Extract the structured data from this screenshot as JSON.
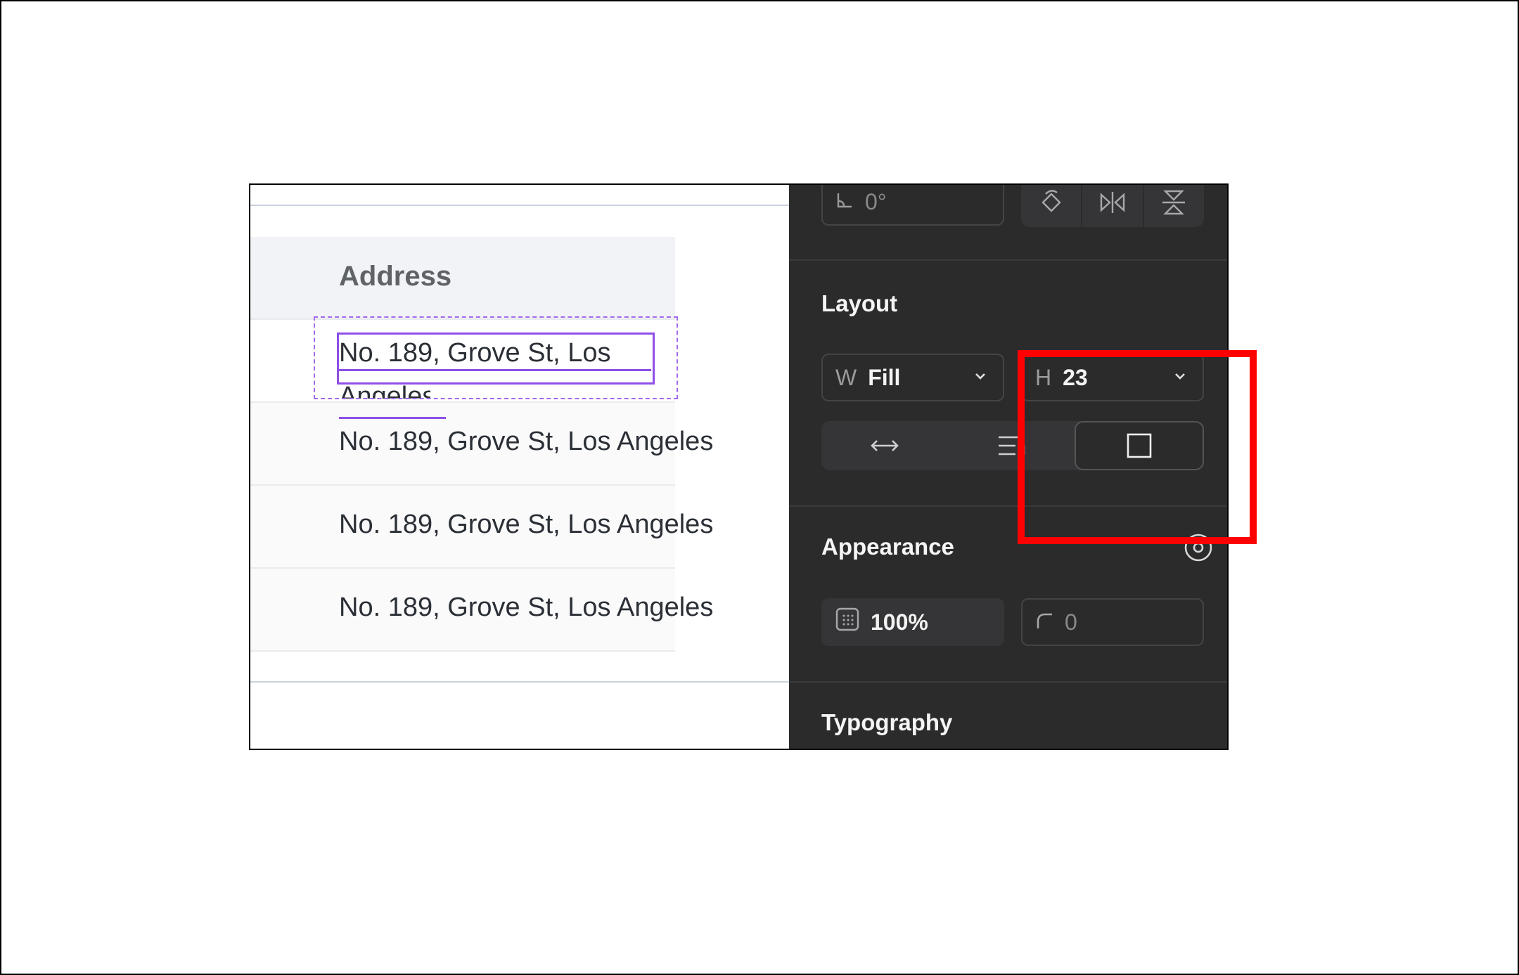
{
  "table": {
    "header": "Address",
    "rows": [
      "No. 189, Grove St, Los",
      "No. 189, Grove St, Los Angeles",
      "No. 189, Grove St, Los Angeles",
      "No. 189, Grove St, Los Angeles"
    ],
    "overflow_suffix": "Angeles"
  },
  "inspector": {
    "rotation": {
      "value": "0°"
    },
    "layout": {
      "title": "Layout",
      "width": {
        "prefix": "W",
        "value": "Fill"
      },
      "height": {
        "prefix": "H",
        "value": "23"
      }
    },
    "appearance": {
      "title": "Appearance",
      "opacity": "100%",
      "radius": "0"
    },
    "typography": {
      "title": "Typography"
    }
  },
  "colors": {
    "panel_bg": "#2b2b2c",
    "selection": "#8e4fe6",
    "highlight": "#ff0000"
  }
}
